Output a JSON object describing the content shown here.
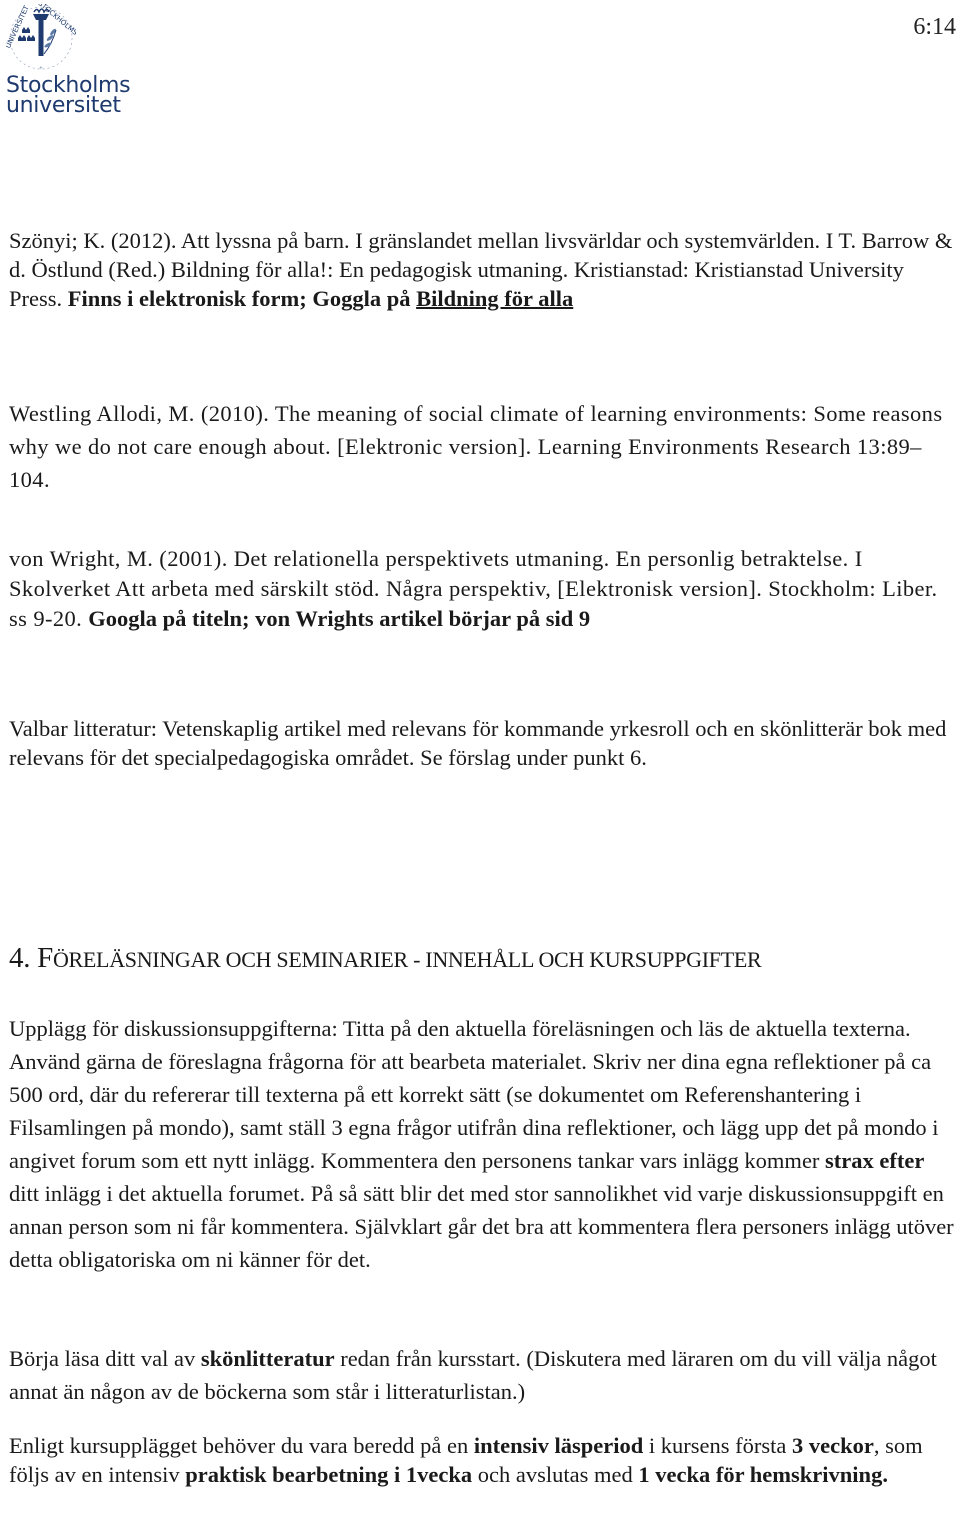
{
  "header": {
    "logo": {
      "name_line1": "Stockholms",
      "name_line2": "universitet",
      "seal_icon": "stockholm-university-seal-icon",
      "brand_color": "#1e3a6e"
    },
    "page_number": "6:14"
  },
  "references": [
    {
      "text": "Szönyi; K. (2012). Att lyssna på barn. I gränslandet mellan livsvärldar och systemvärlden. I T. Barrow & d. Östlund (Red.) Bildning för alla!: En pedagogisk utmaning. Kristianstad: Kristianstad University Press. ",
      "bold_note": "Finns i elektronisk form; Goggla på ",
      "underlined_link": "Bildning för alla"
    },
    {
      "text": "Westling Allodi, M. (2010). The meaning of social climate of learning environments: Some reasons why we do not care enough about. [Elektronic version]. Learning Environments Research  13:89–104."
    },
    {
      "text": "von Wright, M. (2001). Det relationella perspektivets utmaning. En personlig betraktelse. I Skolverket Att arbeta med särskilt stöd. Några perspektiv, [Elektronisk version]. Stockholm: Liber. ss 9-20. ",
      "bold_note": "Googla på titeln; von Wrights artikel börjar på sid 9"
    }
  ],
  "optional_literature": "Valbar litteratur: Vetenskaplig artikel med relevans för kommande yrkesroll och en skönlitterär bok med relevans för det specialpedagogiska området. Se förslag under punkt 6.",
  "section": {
    "number": "4.",
    "first_letter": "F",
    "title_rest": "ÖRELÄSNINGAR OCH SEMINARIER - INNEHÅLL OCH KURSUPPGIFTER"
  },
  "paragraphs": {
    "p1_part1": "Upplägg för diskussionsuppgifterna: Titta på den aktuella föreläsningen och läs de aktuella texterna. Använd gärna de föreslagna frågorna för att bearbeta materialet. Skriv ner dina egna reflektioner på ca 500 ord, där du refererar till texterna på ett korrekt sätt (se dokumentet om Referenshantering i Filsamlingen på mondo), samt ställ 3 egna frågor utifrån dina reflektioner, och lägg upp det på mondo i angivet forum som ett nytt inlägg. Kommentera den personens tankar vars inlägg kommer ",
    "p1_bold": "strax efter",
    "p1_part2": " ditt inlägg i det aktuella forumet. På så sätt blir det med stor sannolikhet vid varje diskussionsuppgift en annan person som ni får kommentera. Självklart går det bra att kommentera flera personers inlägg utöver detta obligatoriska om ni känner för det.",
    "p2_part1": "Börja läsa ditt val av ",
    "p2_bold": "skönlitteratur",
    "p2_part2": " redan från kursstart. (Diskutera med läraren om du vill välja något annat än någon av de böckerna som står i litteraturlistan.)",
    "p3_part1": "Enligt kursupplägget behöver du vara beredd på en ",
    "p3_bold1": "intensiv läsperiod",
    "p3_part2": " i kursens första ",
    "p3_bold2": "3 veckor",
    "p3_part3": ", som följs av en intensiv ",
    "p3_bold3": "praktisk bearbetning i 1vecka",
    "p3_part4": " och avslutas med ",
    "p3_bold4": "1 vecka för hemskrivning."
  }
}
